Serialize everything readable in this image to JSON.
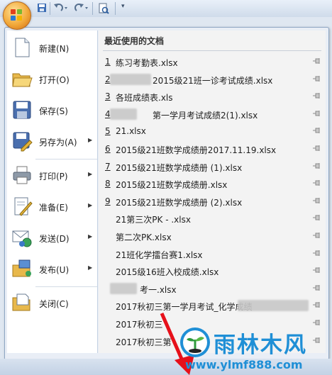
{
  "commands": [
    {
      "name": "new",
      "label": "新建(N)",
      "arrow": false,
      "icon": "new-document-icon"
    },
    {
      "name": "open",
      "label": "打开(O)",
      "arrow": false,
      "icon": "open-folder-icon"
    },
    {
      "name": "save",
      "label": "保存(S)",
      "arrow": false,
      "icon": "save-disk-icon"
    },
    {
      "name": "save-as",
      "label": "另存为(A)",
      "arrow": true,
      "icon": "save-as-icon"
    },
    {
      "name": "print",
      "label": "打印(P)",
      "arrow": true,
      "icon": "printer-icon"
    },
    {
      "name": "prepare",
      "label": "准备(E)",
      "arrow": true,
      "icon": "prepare-icon"
    },
    {
      "name": "send",
      "label": "发送(D)",
      "arrow": true,
      "icon": "send-icon"
    },
    {
      "name": "publish",
      "label": "发布(U)",
      "arrow": true,
      "icon": "publish-icon"
    },
    {
      "name": "close",
      "label": "关闭(C)",
      "arrow": false,
      "icon": "close-folder-icon"
    }
  ],
  "recent": {
    "title": "最近使用的文档",
    "files": [
      {
        "num": "1",
        "name": "练习考勤表.xlsx"
      },
      {
        "num": "2",
        "name": "2015级21班一诊考试成绩.xlsx",
        "blurred": true
      },
      {
        "num": "3",
        "name": "各班成绩表.xls"
      },
      {
        "num": "4",
        "name": "第一学月考试成绩2(1).xlsx",
        "blurred": true
      },
      {
        "num": "5",
        "name": "21.xlsx"
      },
      {
        "num": "6",
        "name": "2015级21班数学成绩册2017.11.19.xlsx"
      },
      {
        "num": "7",
        "name": "2015级21班数学成绩册 (1).xlsx"
      },
      {
        "num": "8",
        "name": "2015级21班数学成绩册.xlsx"
      },
      {
        "num": "9",
        "name": "2015级21班数学成绩册 (2).xlsx"
      },
      {
        "num": "",
        "name": "21第三次PK - .xlsx"
      },
      {
        "num": "",
        "name": "第二次PK.xlsx"
      },
      {
        "num": "",
        "name": "21班化学擂台赛1.xlsx"
      },
      {
        "num": "",
        "name": "2015级16班入校成绩.xlsx"
      },
      {
        "num": "",
        "name": "考一.xlsx",
        "blurred": true
      },
      {
        "num": "",
        "name": "2017秋初三第一学月考试_化学成绩",
        "blurred": true
      },
      {
        "num": "",
        "name": "2017秋初三"
      },
      {
        "num": "",
        "name": "2017秋初三第"
      }
    ]
  },
  "watermark": {
    "title": "雨林木风",
    "url": "www.ylmf888.com"
  },
  "colors": {
    "accent": "#1f8fd6",
    "arrow": "#e6101a"
  }
}
